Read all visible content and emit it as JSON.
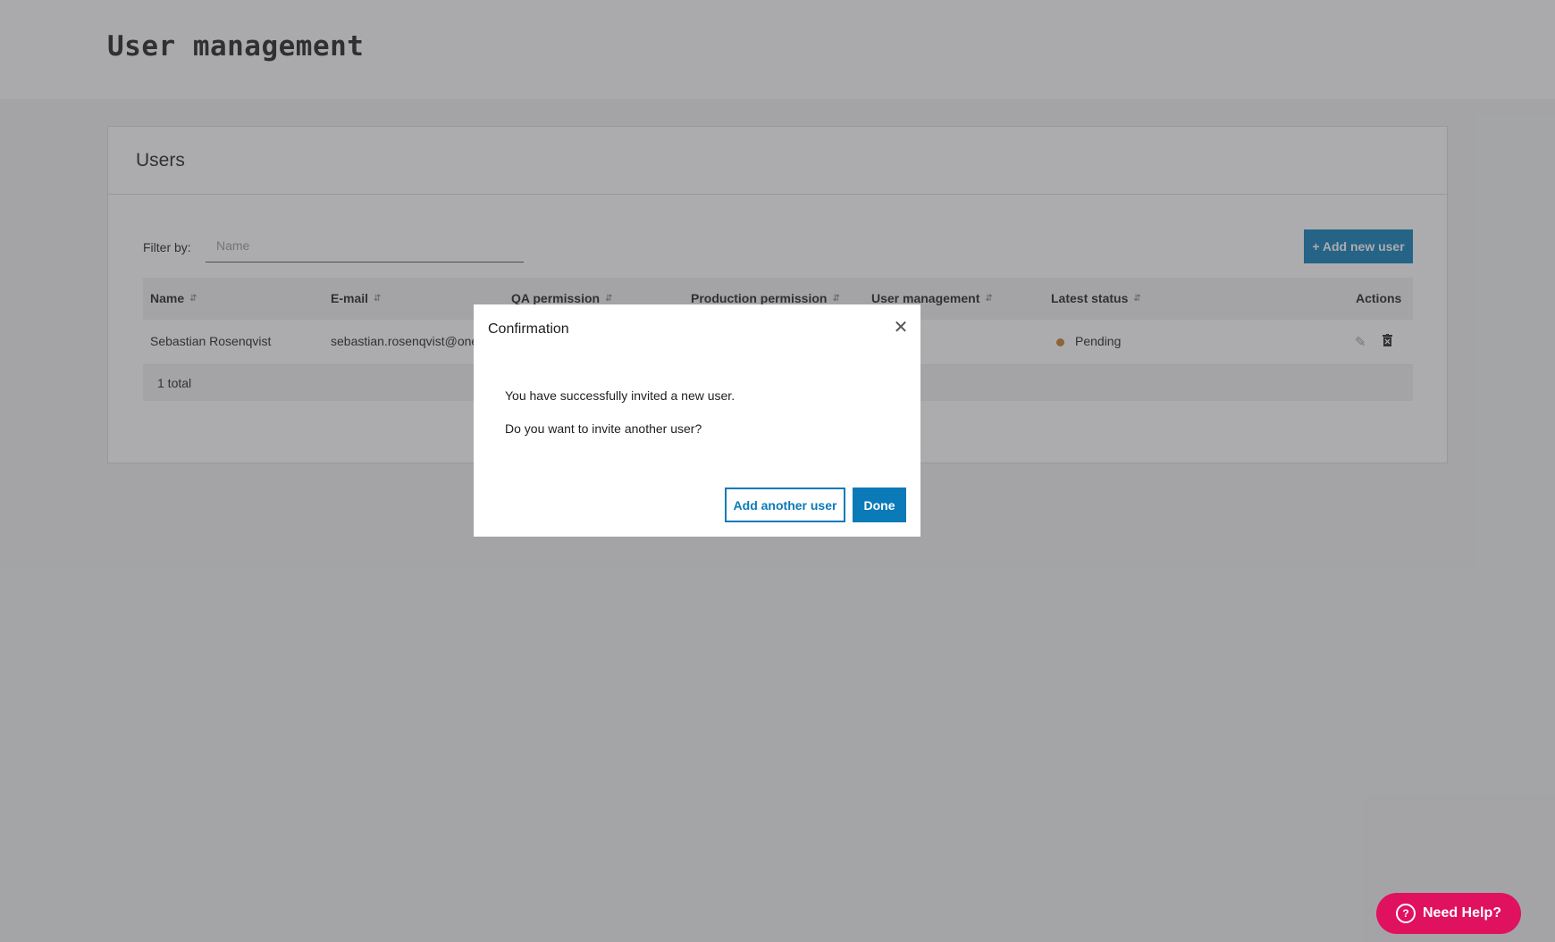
{
  "page": {
    "title": "User management"
  },
  "users_card": {
    "title": "Users",
    "filter_label": "Filter by:",
    "filter_placeholder": "Name",
    "add_button": "+ Add new user"
  },
  "table": {
    "columns": {
      "name": "Name",
      "email": "E-mail",
      "qa": "QA permission",
      "production": "Production permission",
      "user_mgmt": "User management",
      "status": "Latest status",
      "actions": "Actions"
    },
    "rows": [
      {
        "name": "Sebastian Rosenqvist",
        "email": "sebastian.rosenqvist@one",
        "status": "Pending",
        "status_color": "#c97a2a"
      }
    ],
    "footer": "1 total"
  },
  "modal": {
    "title": "Confirmation",
    "close_icon": "close-icon",
    "message_1": "You have successfully invited a new user.",
    "message_2": "Do you want to invite another user?",
    "secondary_button": "Add another user",
    "primary_button": "Done"
  },
  "help": {
    "label": "Need Help?",
    "icon": "question-circle-icon"
  },
  "colors": {
    "accent": "#0a7ab8",
    "help": "#e0115f",
    "pending": "#c97a2a"
  }
}
